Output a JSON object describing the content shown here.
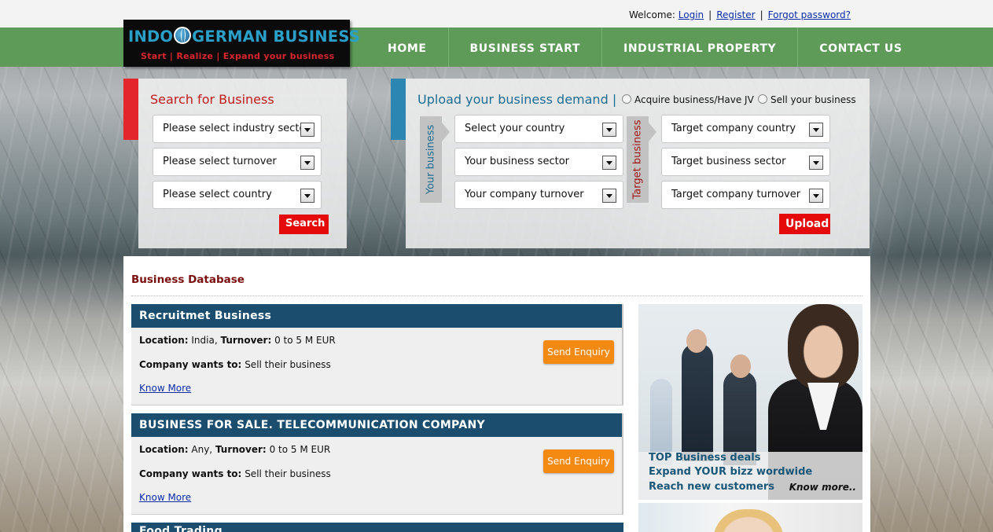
{
  "header": {
    "welcome_label": "Welcome:",
    "login": "Login",
    "register": "Register",
    "forgot": "Forgot password?",
    "separator": "|"
  },
  "logo": {
    "brand_left": "INDO",
    "brand_right": "GERMAN BUSINESS",
    "tagline": "Start | Realize | Expand your business"
  },
  "nav": [
    "HOME",
    "BUSINESS START",
    "INDUSTRIAL PROPERTY",
    "CONTACT US"
  ],
  "search": {
    "title": "Search for Business",
    "industry": "Please select industry sector",
    "turnover": "Please select turnover",
    "country": "Please select country",
    "button": "Search"
  },
  "upload": {
    "title": "Upload your business demand",
    "divider": "|",
    "radio_acquire": "Acquire business/Have JV",
    "radio_sell": "Sell your business",
    "your_label": "Your business",
    "target_label": "Target business",
    "your_country": "Select your country",
    "your_sector": "Your business sector",
    "your_turnover": "Your company turnover",
    "target_country": "Target company country",
    "target_sector": "Target business sector",
    "target_turnover": "Target company turnover",
    "button": "Upload"
  },
  "database": {
    "title": "Business Database",
    "cards": [
      {
        "title": "Recruitmet Business",
        "location_label": "Location:",
        "location": "India,",
        "turnover_label": "Turnover:",
        "turnover": "0 to 5 M EUR",
        "wants_label": "Company wants to:",
        "wants": "Sell their business",
        "link": "Know More",
        "button": "Send Enquiry"
      },
      {
        "title": "BUSINESS FOR SALE. TELECOMMUNICATION COMPANY",
        "location_label": "Location:",
        "location": "Any,",
        "turnover_label": "Turnover:",
        "turnover": "0 to 5 M EUR",
        "wants_label": "Company wants to:",
        "wants": "Sell their business",
        "link": "Know More",
        "button": "Send Enquiry"
      }
    ],
    "third_card_title": "Food Trading"
  },
  "promo": {
    "line1": "TOP Business deals",
    "line2": "Expand YOUR bizz wordwide",
    "line3": "Reach new customers",
    "more": "Know more.."
  },
  "colors": {
    "nav_green": "#5e9a58",
    "accent_red": "#e50b0b",
    "card_header": "#1b4e6e",
    "enquiry_orange": "#f58a12",
    "upload_title": "#1d6e94"
  }
}
